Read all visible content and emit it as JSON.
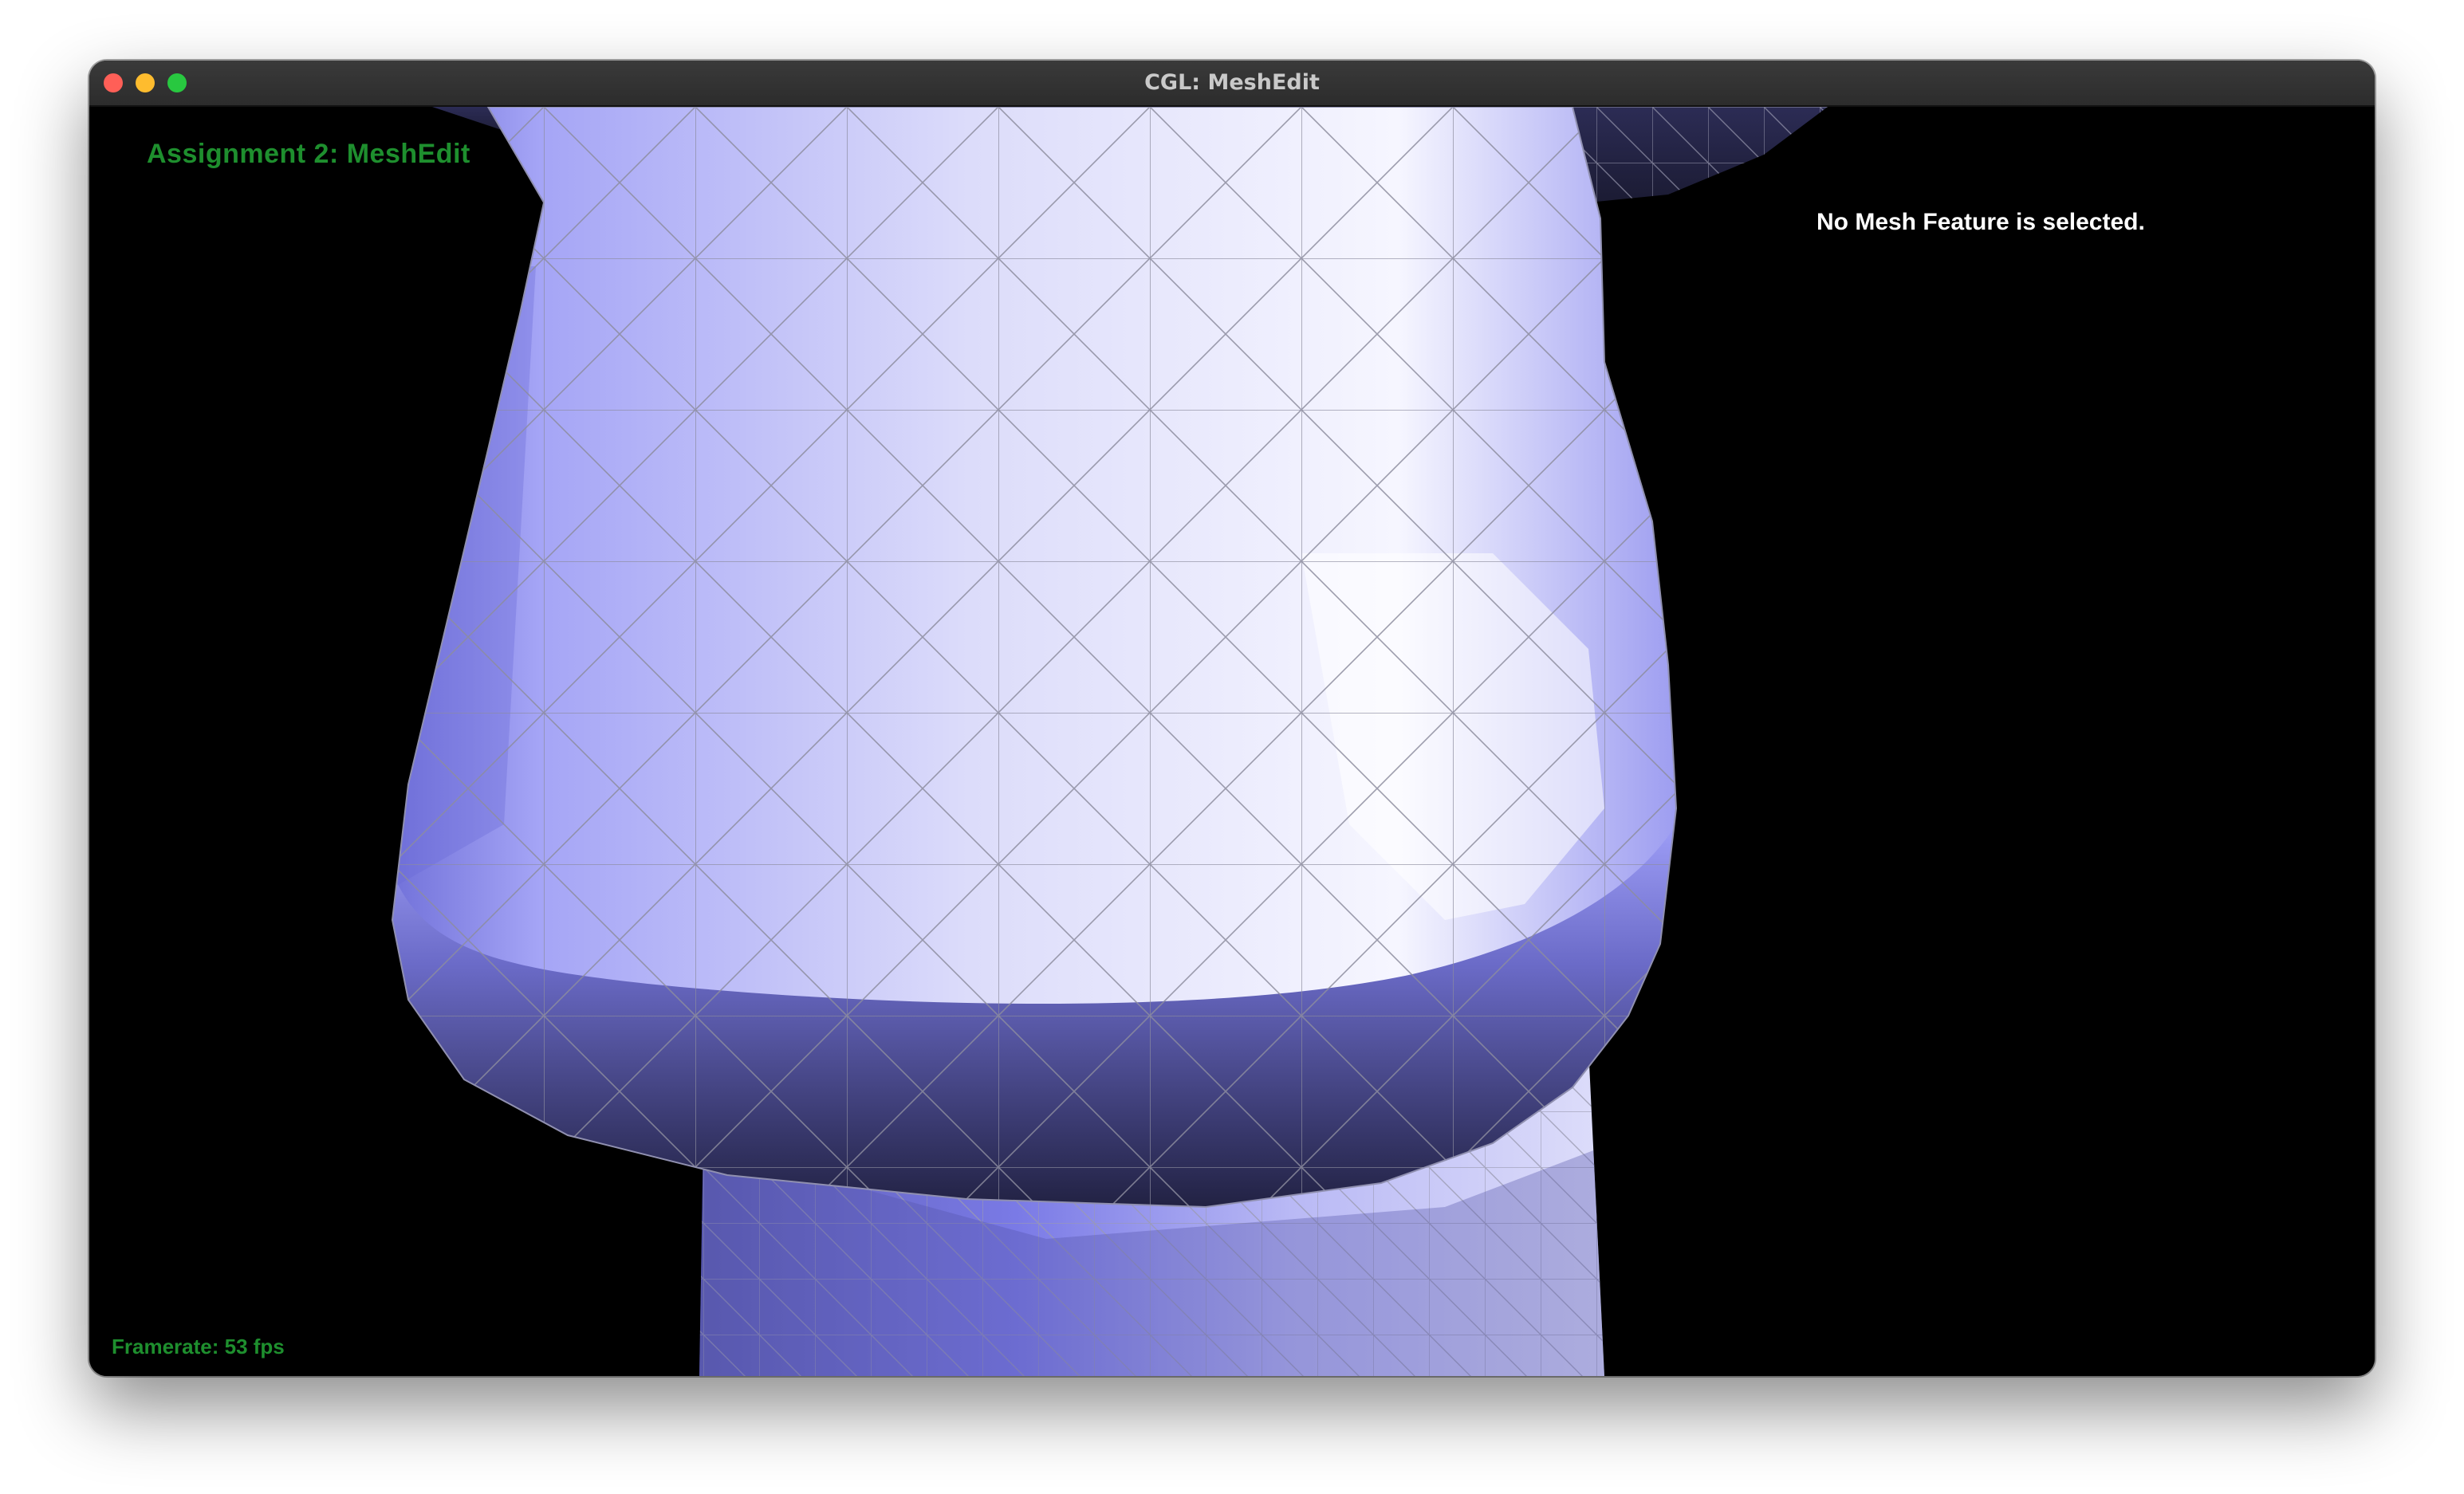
{
  "window": {
    "title": "CGL: MeshEdit"
  },
  "overlay": {
    "assignment_title": "Assignment 2: MeshEdit",
    "selection_status": "No Mesh Feature is selected.",
    "framerate": "Framerate: 53 fps"
  },
  "viewport": {
    "content": "mesh-render-icon",
    "colors": {
      "background": "#000000",
      "mesh_light": "#e8e8fb",
      "mesh_mid": "#a9a9f5",
      "mesh_dark": "#3b3a6e",
      "wireframe": "#8a8a9a",
      "overlay_text_green": "#1e8f2e",
      "overlay_text_white": "#ffffff"
    }
  }
}
